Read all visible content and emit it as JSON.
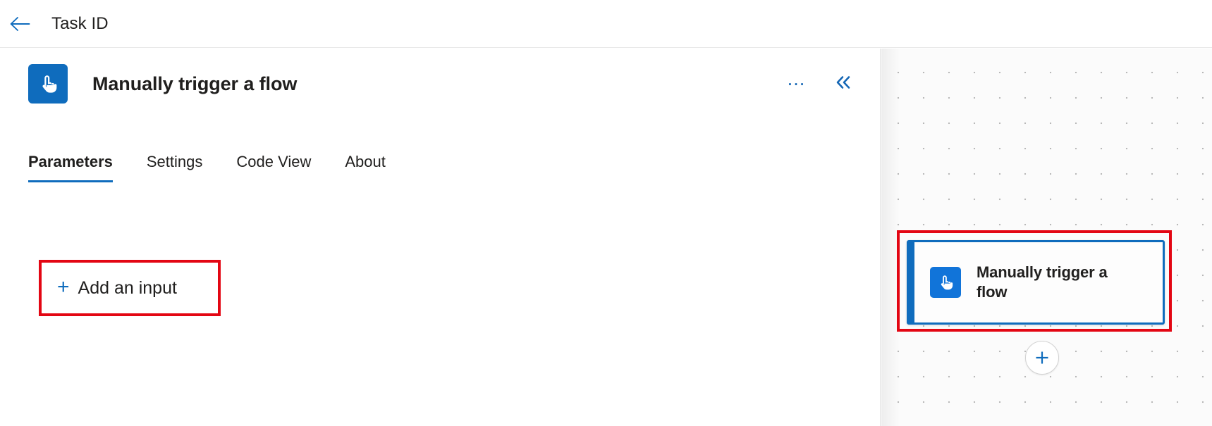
{
  "topbar": {
    "back_icon": "arrow-left-icon",
    "title": "Task ID"
  },
  "panel": {
    "icon": "manual-trigger-tap-icon",
    "title": "Manually trigger a flow",
    "actions": {
      "more_label": "…",
      "more_icon": "ellipsis-icon",
      "collapse_label": "«",
      "collapse_icon": "chevron-double-left-icon"
    },
    "tabs": [
      {
        "label": "Parameters",
        "selected": true
      },
      {
        "label": "Settings",
        "selected": false
      },
      {
        "label": "Code View",
        "selected": false
      },
      {
        "label": "About",
        "selected": false
      }
    ],
    "add_input": {
      "plus": "+",
      "label": "Add an input",
      "icon": "plus-icon"
    }
  },
  "canvas": {
    "node": {
      "icon": "manual-trigger-tap-icon",
      "title": "Manually trigger a flow",
      "selected": true
    },
    "add_node": {
      "icon": "plus-circle-icon"
    }
  },
  "colors": {
    "accent_blue": "#0f6cbd",
    "link_blue": "#1567b5",
    "annotation_red": "#e30613",
    "text_primary": "#201f1e",
    "canvas_background": "#fbfbfb"
  }
}
